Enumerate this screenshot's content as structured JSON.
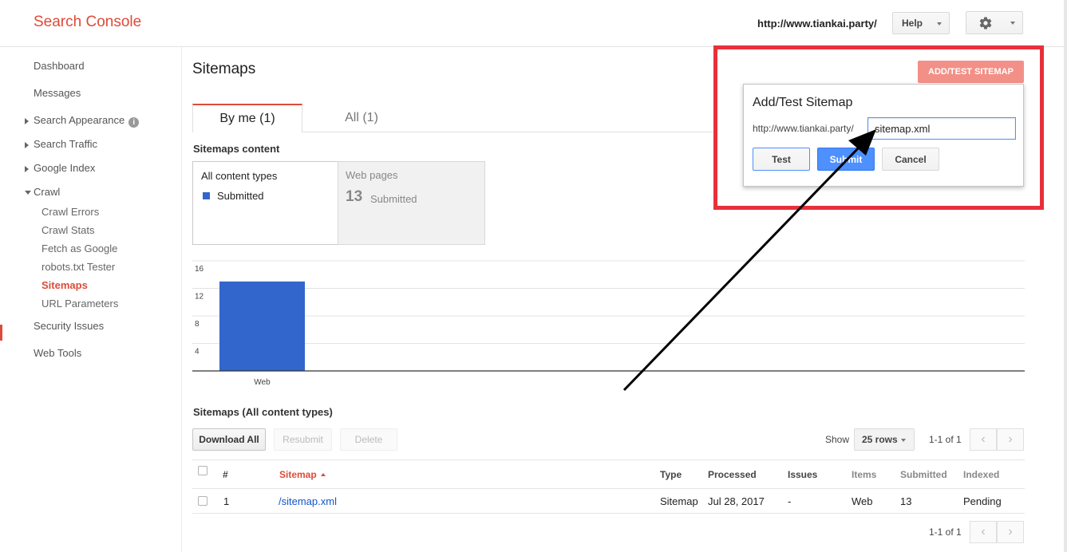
{
  "header": {
    "logo": "Search Console",
    "site_url": "http://www.tiankai.party/",
    "help_label": "Help",
    "settings_icon": "gear-icon"
  },
  "sidebar": {
    "dashboard": "Dashboard",
    "messages": "Messages",
    "search_appearance": "Search Appearance",
    "search_traffic": "Search Traffic",
    "google_index": "Google Index",
    "crawl": "Crawl",
    "crawl_items": [
      "Crawl Errors",
      "Crawl Stats",
      "Fetch as Google",
      "robots.txt Tester",
      "Sitemaps",
      "URL Parameters"
    ],
    "security_issues": "Security Issues",
    "web_tools": "Web Tools",
    "active_item": "Sitemaps"
  },
  "page": {
    "title": "Sitemaps",
    "tabs": [
      {
        "label": "By me (1)",
        "active": true
      },
      {
        "label": "All (1)",
        "active": false
      }
    ],
    "add_button": "ADD/TEST SITEMAP"
  },
  "content": {
    "section_title": "Sitemaps content",
    "all_types_title": "All content types",
    "legend_submitted": "Submitted",
    "web_pages_title": "Web pages",
    "web_pages_count": "13",
    "web_pages_label": "Submitted"
  },
  "chart_data": {
    "type": "bar",
    "categories": [
      "Web"
    ],
    "values": [
      13
    ],
    "ylim": [
      0,
      16
    ],
    "yticks": [
      4,
      8,
      12,
      16
    ],
    "color": "#3366cc",
    "grid": true
  },
  "table": {
    "section_title": "Sitemaps (All content types)",
    "buttons": {
      "download": "Download All",
      "resubmit": "Resubmit",
      "delete": "Delete"
    },
    "show_label": "Show",
    "rows_option": "25 rows",
    "pager_top": "1-1 of 1",
    "pager_bottom": "1-1 of 1",
    "columns": [
      "#",
      "Sitemap",
      "Type",
      "Processed",
      "Issues",
      "Items",
      "Submitted",
      "Indexed"
    ],
    "rows": [
      {
        "num": "1",
        "sitemap": "/sitemap.xml",
        "type": "Sitemap",
        "processed": "Jul 28, 2017",
        "issues": "-",
        "items": "Web",
        "submitted": "13",
        "indexed": "Pending"
      }
    ]
  },
  "dialog": {
    "title": "Add/Test Sitemap",
    "prefix": "http://www.tiankai.party/",
    "input_value": "sitemap.xml",
    "test_label": "Test",
    "submit_label": "Submit",
    "cancel_label": "Cancel"
  },
  "colors": {
    "brand": "#dd4b39",
    "bar": "#3366cc",
    "highlight_frame": "#e8303a",
    "submit_button": "#4d90fe"
  }
}
